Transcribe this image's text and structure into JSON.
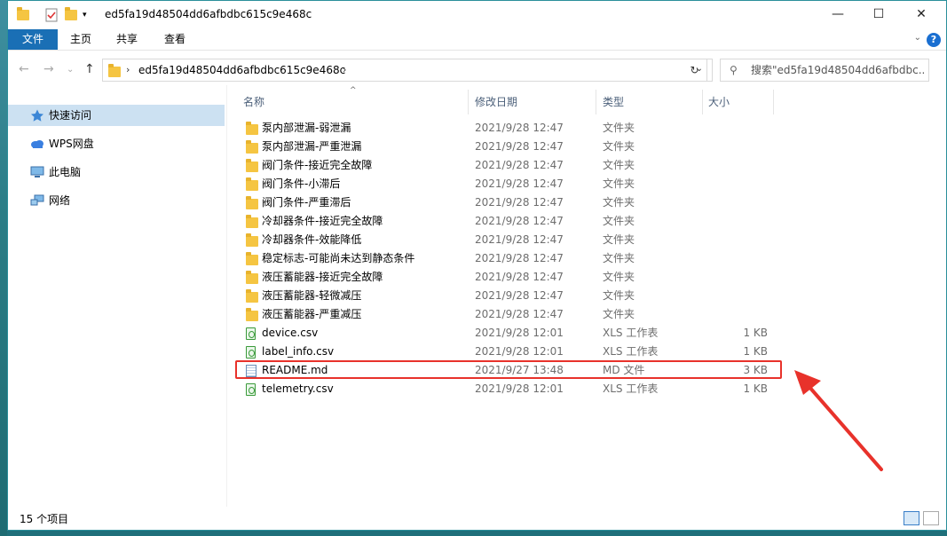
{
  "window": {
    "title": "ed5fa19d48504dd6afbdbc615c9e468c"
  },
  "window_controls": {
    "minimize": "—",
    "maximize": "☐",
    "close": "✕"
  },
  "ribbon": {
    "tabs": [
      {
        "label": "文件"
      },
      {
        "label": "主页"
      },
      {
        "label": "共享"
      },
      {
        "label": "查看"
      }
    ],
    "help": "?"
  },
  "address": {
    "path": "ed5fa19d48504dd6afbdbc615c9e468c"
  },
  "search": {
    "placeholder": "搜索\"ed5fa19d48504dd6afbdbc..."
  },
  "nav": {
    "items": [
      {
        "label": "快速访问",
        "icon": "star-icon"
      },
      {
        "label": "WPS网盘",
        "icon": "cloud-icon"
      },
      {
        "label": "此电脑",
        "icon": "computer-icon"
      },
      {
        "label": "网络",
        "icon": "network-icon"
      }
    ]
  },
  "columns": {
    "name": "名称",
    "date": "修改日期",
    "type": "类型",
    "size": "大小"
  },
  "files": [
    {
      "name": "泵内部泄漏-弱泄漏",
      "date": "2021/9/28 12:47",
      "type": "文件夹",
      "size": "",
      "kind": "folder"
    },
    {
      "name": "泵内部泄漏-严重泄漏",
      "date": "2021/9/28 12:47",
      "type": "文件夹",
      "size": "",
      "kind": "folder"
    },
    {
      "name": "阀门条件-接近完全故障",
      "date": "2021/9/28 12:47",
      "type": "文件夹",
      "size": "",
      "kind": "folder"
    },
    {
      "name": "阀门条件-小滞后",
      "date": "2021/9/28 12:47",
      "type": "文件夹",
      "size": "",
      "kind": "folder"
    },
    {
      "name": "阀门条件-严重滞后",
      "date": "2021/9/28 12:47",
      "type": "文件夹",
      "size": "",
      "kind": "folder"
    },
    {
      "name": "冷却器条件-接近完全故障",
      "date": "2021/9/28 12:47",
      "type": "文件夹",
      "size": "",
      "kind": "folder"
    },
    {
      "name": "冷却器条件-效能降低",
      "date": "2021/9/28 12:47",
      "type": "文件夹",
      "size": "",
      "kind": "folder"
    },
    {
      "name": "稳定标志-可能尚未达到静态条件",
      "date": "2021/9/28 12:47",
      "type": "文件夹",
      "size": "",
      "kind": "folder"
    },
    {
      "name": "液压蓄能器-接近完全故障",
      "date": "2021/9/28 12:47",
      "type": "文件夹",
      "size": "",
      "kind": "folder"
    },
    {
      "name": "液压蓄能器-轻微减压",
      "date": "2021/9/28 12:47",
      "type": "文件夹",
      "size": "",
      "kind": "folder"
    },
    {
      "name": "液压蓄能器-严重减压",
      "date": "2021/9/28 12:47",
      "type": "文件夹",
      "size": "",
      "kind": "folder"
    },
    {
      "name": "device.csv",
      "date": "2021/9/28 12:01",
      "type": "XLS 工作表",
      "size": "1 KB",
      "kind": "csv"
    },
    {
      "name": "label_info.csv",
      "date": "2021/9/28 12:01",
      "type": "XLS 工作表",
      "size": "1 KB",
      "kind": "csv"
    },
    {
      "name": "README.md",
      "date": "2021/9/27 13:48",
      "type": "MD 文件",
      "size": "3 KB",
      "kind": "md"
    },
    {
      "name": "telemetry.csv",
      "date": "2021/9/28 12:01",
      "type": "XLS 工作表",
      "size": "1 KB",
      "kind": "csv"
    }
  ],
  "status": {
    "count": "15 个项目"
  },
  "colors": {
    "accent": "#1a6fb5",
    "selection": "#cce1f2",
    "highlight_box": "#e8322b",
    "folder": "#f5c542"
  }
}
